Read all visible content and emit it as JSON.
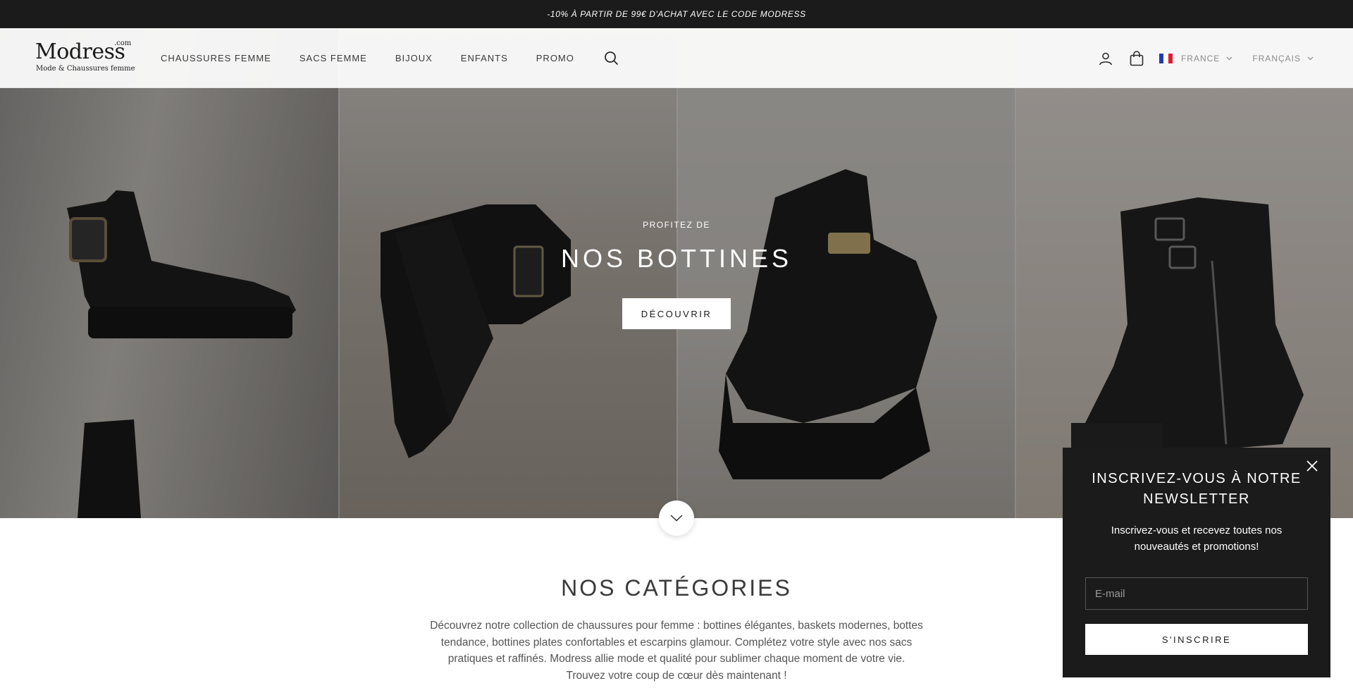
{
  "announcement": {
    "text": "-10% À PARTIR DE 99€ D'ACHAT AVEC LE CODE MODRESS"
  },
  "header": {
    "logo": {
      "wordmark": "Modress",
      "suffix": ".com",
      "tagline": "Mode & Chaussures femme"
    },
    "nav": [
      {
        "label": "CHAUSSURES FEMME"
      },
      {
        "label": "SACS FEMME"
      },
      {
        "label": "BIJOUX"
      },
      {
        "label": "ENFANTS"
      },
      {
        "label": "PROMO"
      }
    ],
    "icons": {
      "search": "search-icon",
      "account": "user-icon",
      "cart": "shopping-bag-icon"
    },
    "country_selector": {
      "value": "FRANCE",
      "flag": "france-flag",
      "flag_colors": [
        "#1f3ea8",
        "#ffffff",
        "#e01b2f"
      ]
    },
    "language_selector": {
      "value": "FRANÇAIS"
    }
  },
  "hero": {
    "eyebrow": "PROFITEZ DE",
    "title": "NOS BOTTINES",
    "cta_label": "DÉCOUVRIR",
    "scroll_icon": "chevron-down-icon"
  },
  "categories": {
    "title": "NOS CATÉGORIES",
    "description": "Découvrez notre collection de chaussures pour femme : bottines élégantes, baskets modernes, bottes tendance, bottines plates confortables et escarpins glamour. Complétez votre style avec nos sacs pratiques et raffinés. Modress allie mode et qualité pour sublimer chaque moment de votre vie. Trouvez votre coup de cœur dès maintenant !"
  },
  "newsletter": {
    "title": "INSCRIVEZ-VOUS À NOTRE NEWSLETTER",
    "text": "Inscrivez-vous et recevez toutes nos nouveautés et promotions!",
    "email_placeholder": "E-mail",
    "submit_label": "S'INSCRIRE",
    "close_icon": "close-icon"
  },
  "colors": {
    "dark": "#1b1b1b",
    "text": "#3a3a3a",
    "white": "#ffffff"
  }
}
